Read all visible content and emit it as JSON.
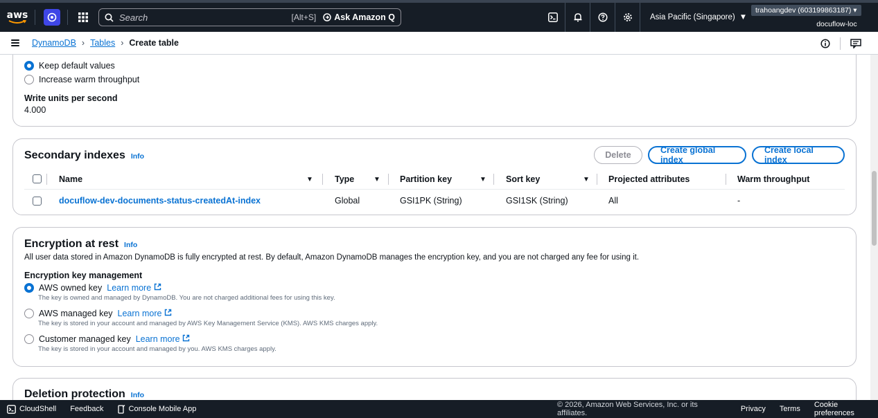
{
  "topnav": {
    "logo_text": "aws",
    "search_placeholder": "Search",
    "search_shortcut": "[Alt+S]",
    "ask_q_label": "Ask Amazon Q",
    "region": "Asia Pacific (Singapore)",
    "account": "trahoangdev (603199863187)",
    "tenant": "docuflow-loc"
  },
  "breadcrumb": {
    "items": [
      "DynamoDB",
      "Tables"
    ],
    "current": "Create table"
  },
  "capacity": {
    "options": [
      "Keep default values",
      "Increase warm throughput"
    ],
    "selected": 0,
    "write_units_label": "Write units per second",
    "write_units_value": "4.000"
  },
  "secondary_indexes": {
    "title": "Secondary indexes",
    "info": "Info",
    "buttons": {
      "delete": "Delete",
      "create_global": "Create global index",
      "create_local": "Create local index"
    },
    "columns": [
      "Name",
      "Type",
      "Partition key",
      "Sort key",
      "Projected attributes",
      "Warm throughput"
    ],
    "rows": [
      {
        "name": "docuflow-dev-documents-status-createdAt-index",
        "type": "Global",
        "partition_key": "GSI1PK (String)",
        "sort_key": "GSI1SK (String)",
        "projected": "All",
        "warm": "-"
      }
    ]
  },
  "encryption": {
    "title": "Encryption at rest",
    "info": "Info",
    "description": "All user data stored in Amazon DynamoDB is fully encrypted at rest. By default, Amazon DynamoDB manages the encryption key, and you are not charged any fee for using it.",
    "key_mgmt_label": "Encryption key management",
    "learn_more": "Learn more",
    "options": [
      {
        "label": "AWS owned key",
        "desc": "The key is owned and managed by DynamoDB. You are not charged additional fees for using this key."
      },
      {
        "label": "AWS managed key",
        "desc": "The key is stored in your account and managed by AWS Key Management Service (KMS). AWS KMS charges apply."
      },
      {
        "label": "Customer managed key",
        "desc": "The key is stored in your account and managed by you. AWS KMS charges apply."
      }
    ],
    "selected": 0
  },
  "deletion": {
    "title": "Deletion protection",
    "info": "Info"
  },
  "footer": {
    "cloudshell": "CloudShell",
    "feedback": "Feedback",
    "mobile_app": "Console Mobile App",
    "copyright": "© 2026, Amazon Web Services, Inc. or its affiliates.",
    "privacy": "Privacy",
    "terms": "Terms",
    "cookie": "Cookie preferences"
  },
  "colors": {
    "accent": "#0972d3",
    "nav_bg": "#161d26"
  }
}
